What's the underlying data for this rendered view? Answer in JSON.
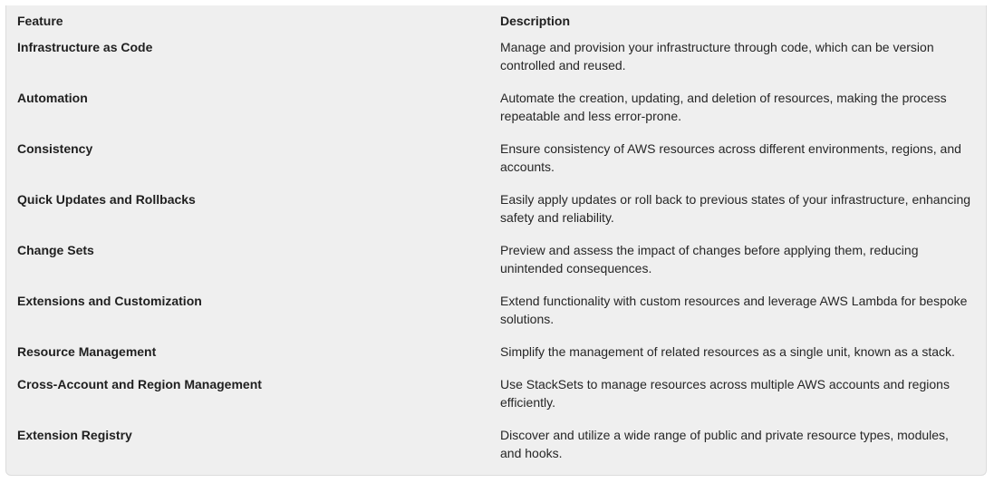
{
  "table": {
    "headers": {
      "feature": "Feature",
      "description": "Description"
    },
    "rows": [
      {
        "feature": "Infrastructure as Code",
        "description": "Manage and provision your infrastructure through code, which can be version controlled and reused."
      },
      {
        "feature": "Automation",
        "description": "Automate the creation, updating, and deletion of resources, making the process repeatable and less error-prone."
      },
      {
        "feature": "Consistency",
        "description": "Ensure consistency of AWS resources across different environments, regions, and accounts."
      },
      {
        "feature": "Quick Updates and Rollbacks",
        "description": "Easily apply updates or roll back to previous states of your infrastructure, enhancing safety and reliability."
      },
      {
        "feature": "Change Sets",
        "description": "Preview and assess the impact of changes before applying them, reducing unintended consequences."
      },
      {
        "feature": "Extensions and Customization",
        "description": "Extend functionality with custom resources and leverage AWS Lambda for bespoke solutions."
      },
      {
        "feature": "Resource Management",
        "description": "Simplify the management of related resources as a single unit, known as a stack."
      },
      {
        "feature": "Cross-Account and Region Management",
        "description": "Use StackSets to manage resources across multiple AWS accounts and regions efficiently."
      },
      {
        "feature": "Extension Registry",
        "description": "Discover and utilize a wide range of public and private resource types, modules, and hooks."
      }
    ]
  }
}
